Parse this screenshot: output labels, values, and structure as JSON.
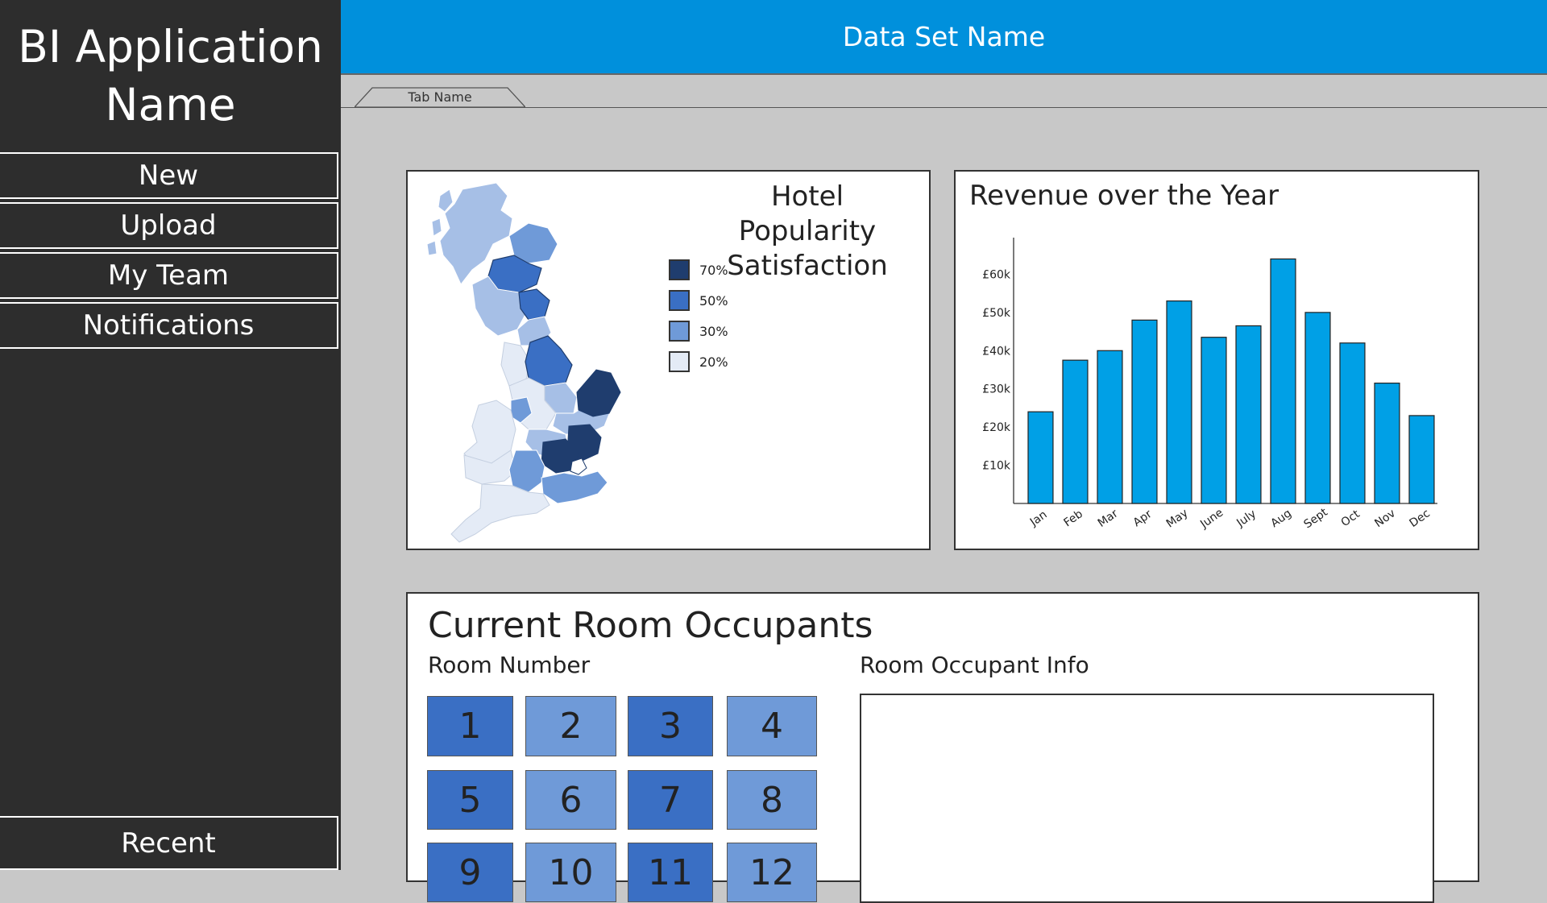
{
  "app": {
    "title_line1": "BI Application",
    "title_line2": "Name"
  },
  "sidebar": {
    "items": [
      {
        "label": "New"
      },
      {
        "label": "Upload"
      },
      {
        "label": "My Team"
      },
      {
        "label": "Notifications"
      }
    ],
    "recent_label": "Recent"
  },
  "header": {
    "dataset_name": "Data Set Name"
  },
  "tabs": [
    {
      "label": "Tab Name"
    }
  ],
  "map_panel": {
    "title_line1": "Hotel Popularity",
    "title_line2": "Satisfaction",
    "legend": [
      {
        "label": "70%",
        "color": "#1f3d6e"
      },
      {
        "label": "50%",
        "color": "#3a6fc4"
      },
      {
        "label": "30%",
        "color": "#6f9ad8"
      },
      {
        "label": "20%",
        "color": "#e4ebf6"
      }
    ]
  },
  "revenue_panel": {
    "chart_data": {
      "type": "bar",
      "title": "Revenue over the Year",
      "categories": [
        "Jan",
        "Feb",
        "Mar",
        "Apr",
        "May",
        "June",
        "July",
        "Aug",
        "Sept",
        "Oct",
        "Nov",
        "Dec"
      ],
      "values": [
        24,
        37.5,
        40,
        48,
        53,
        43.5,
        46.5,
        64,
        50,
        42,
        31.5,
        23
      ],
      "ytick_labels": [
        "£10k",
        "£20k",
        "£30k",
        "£40k",
        "£50k",
        "£60k"
      ],
      "ytick_values": [
        10,
        20,
        30,
        40,
        50,
        60
      ],
      "ylim": [
        0,
        70
      ],
      "bar_color": "#00a0e6",
      "grid": false
    }
  },
  "occupants": {
    "title": "Current Room Occupants",
    "room_number_label": "Room Number",
    "info_label": "Room Occupant Info",
    "rooms": [
      {
        "number": "1",
        "color": "#3a6fc4"
      },
      {
        "number": "2",
        "color": "#6f9ad8"
      },
      {
        "number": "3",
        "color": "#3a6fc4"
      },
      {
        "number": "4",
        "color": "#6f9ad8"
      },
      {
        "number": "5",
        "color": "#3a6fc4"
      },
      {
        "number": "6",
        "color": "#6f9ad8"
      },
      {
        "number": "7",
        "color": "#3a6fc4"
      },
      {
        "number": "8",
        "color": "#6f9ad8"
      },
      {
        "number": "9",
        "color": "#3a6fc4"
      },
      {
        "number": "10",
        "color": "#6f9ad8"
      },
      {
        "number": "11",
        "color": "#3a6fc4"
      },
      {
        "number": "12",
        "color": "#6f9ad8"
      }
    ]
  }
}
